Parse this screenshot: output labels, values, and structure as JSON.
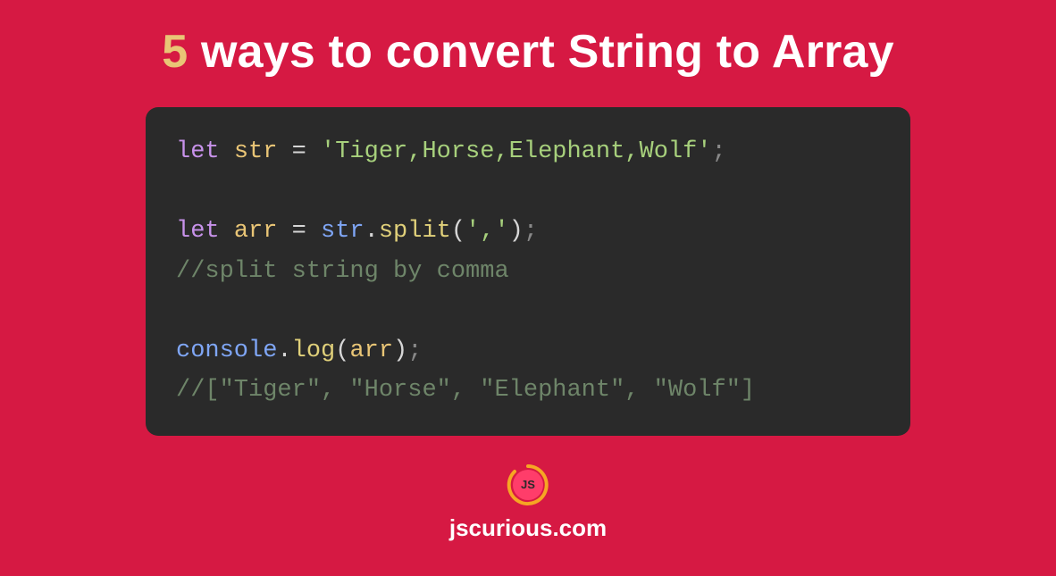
{
  "title": {
    "accent": "5",
    "rest": " ways to convert String to Array"
  },
  "code": {
    "line1": {
      "let": "let",
      "var": "str",
      "eq": "=",
      "str": "'Tiger,Horse,Elephant,Wolf'",
      "semi": ";"
    },
    "line3": {
      "let": "let",
      "var": "arr",
      "eq": "=",
      "obj": "str",
      "dot": ".",
      "call": "split",
      "open": "(",
      "arg": "','",
      "close": ")",
      "semi": ";"
    },
    "line4": "//split string by comma",
    "line6": {
      "obj": "console",
      "dot": ".",
      "call": "log",
      "open": "(",
      "arg": "arr",
      "close": ")",
      "semi": ";"
    },
    "line7": "//[\"Tiger\", \"Horse\", \"Elephant\", \"Wolf\"]"
  },
  "logo_text": "JS",
  "site": "jscurious.com",
  "colors": {
    "bg": "#d61943",
    "code_bg": "#2a2a2a",
    "accent": "#e9c576",
    "logo_fill": "#ff3d6a"
  }
}
